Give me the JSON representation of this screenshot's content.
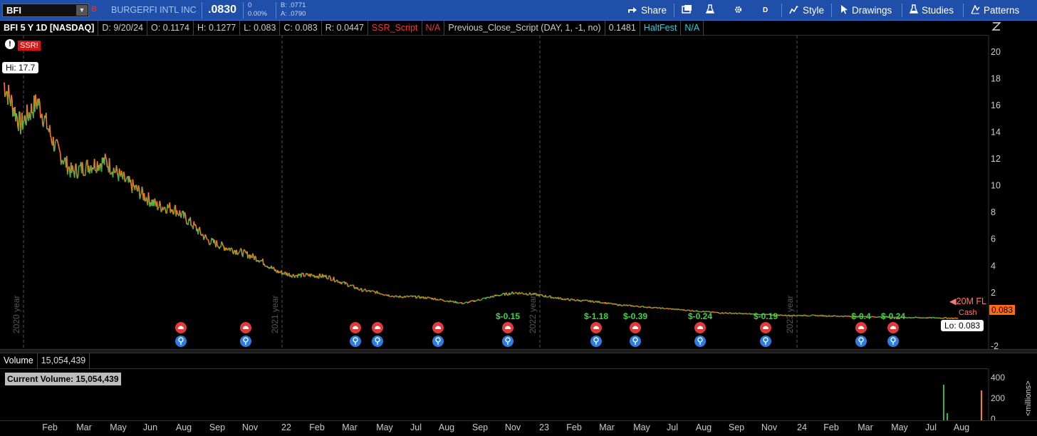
{
  "toolbar": {
    "symbol": "BFI",
    "symbol_mark": "B",
    "company": "BURGERFI INTL INC",
    "last": ".0830",
    "change_top": "0",
    "change_bottom": "0.00%",
    "bid": "B: .0771",
    "ask": "A: .0790",
    "share": "Share",
    "timeframe": "D",
    "style": "Style",
    "drawings": "Drawings",
    "studies": "Studies",
    "patterns": "Patterns"
  },
  "info": {
    "title": "BFI 5 Y 1D [NASDAQ]",
    "date": "D: 9/20/24",
    "open": "O: 0.1174",
    "high": "H: 0.1277",
    "low": "L: 0.083",
    "close": "C: 0.083",
    "range": "R: 0.0447",
    "ssr_label": "SSR_Script",
    "ssr_value": "N/A",
    "prev_close": "Previous_Close_Script (DAY, 1, -1, no)",
    "prev_value": "0.1481",
    "halt_label": "HaltFest",
    "halt_value": "N/A"
  },
  "chart": {
    "ssr_badge": "SSR!",
    "hi_label": "Hi: 17.7",
    "lo_label": "Lo: 0.083",
    "last_label": "0.083",
    "float_label": "20M FL",
    "cash_label": "Cash",
    "year_labels": [
      "2020 year",
      "2021 year",
      "2022 year",
      "2023 year"
    ],
    "dividend_labels": [
      "$-0.15",
      "$-1.18",
      "$-0.39",
      "$-0.24",
      "$-0.19",
      "$-0.4",
      "$-0.24"
    ],
    "y_ticks": [
      "20",
      "18",
      "16",
      "14",
      "12",
      "10",
      "8",
      "6",
      "4",
      "2",
      "-2"
    ],
    "colors": {
      "up": "#3cb043",
      "down": "#ff7a1a",
      "accent": "#1f4fa8"
    }
  },
  "volume": {
    "label": "Volume",
    "value": "15,054,439",
    "current": "Current Volume: 15,054,439",
    "y_ticks": [
      "400",
      "200",
      "0"
    ],
    "unit": "<millions>"
  },
  "xaxis": [
    "Feb",
    "Mar",
    "May",
    "Jun",
    "Aug",
    "Sep",
    "Nov",
    "22",
    "Feb",
    "Mar",
    "May",
    "Jul",
    "Aug",
    "Sep",
    "Nov",
    "23",
    "Feb",
    "Mar",
    "May",
    "Jul",
    "Aug",
    "Sep",
    "Nov",
    "24",
    "Feb",
    "Mar",
    "May",
    "Jul",
    "Aug"
  ],
  "chart_data": {
    "type": "line",
    "title": "BFI 5 Y 1D [NASDAQ]",
    "ylabel": "",
    "ylim": [
      -2,
      21
    ],
    "x": [
      "2020-01",
      "2020-02",
      "2020-03",
      "2020-04",
      "2020-05",
      "2020-06",
      "2020-07",
      "2020-08",
      "2020-09",
      "2020-10",
      "2020-11",
      "2020-12",
      "2021-01",
      "2021-02",
      "2021-03",
      "2021-04",
      "2021-05",
      "2021-06",
      "2021-07",
      "2021-08",
      "2021-09",
      "2021-10",
      "2021-11",
      "2021-12",
      "2022-01",
      "2022-02",
      "2022-03",
      "2022-04",
      "2022-05",
      "2022-06",
      "2022-07",
      "2022-08",
      "2022-09",
      "2022-10",
      "2022-11",
      "2022-12",
      "2023-01",
      "2023-02",
      "2023-03",
      "2023-04",
      "2023-05",
      "2023-06",
      "2023-07",
      "2023-08",
      "2023-09",
      "2023-10",
      "2023-11",
      "2023-12",
      "2024-01",
      "2024-02",
      "2024-03",
      "2024-04",
      "2024-05",
      "2024-06",
      "2024-07",
      "2024-08",
      "2024-09"
    ],
    "series": [
      {
        "values": [
          17.7,
          14.5,
          16.3,
          13.0,
          11.0,
          11.5,
          11.8,
          10.5,
          9.5,
          8.5,
          8.3,
          7.2,
          5.9,
          5.4,
          5.0,
          4.5,
          3.6,
          3.3,
          3.3,
          3.2,
          2.7,
          2.2,
          2.0,
          1.7,
          1.7,
          1.6,
          1.4,
          1.2,
          1.5,
          1.8,
          2.0,
          1.9,
          1.7,
          1.5,
          1.4,
          1.3,
          1.1,
          1.0,
          0.9,
          0.8,
          0.7,
          0.6,
          0.5,
          0.45,
          0.4,
          0.35,
          0.3,
          0.3,
          0.28,
          0.25,
          0.22,
          0.2,
          0.18,
          0.15,
          0.13,
          0.12,
          0.083
        ]
      }
    ]
  }
}
